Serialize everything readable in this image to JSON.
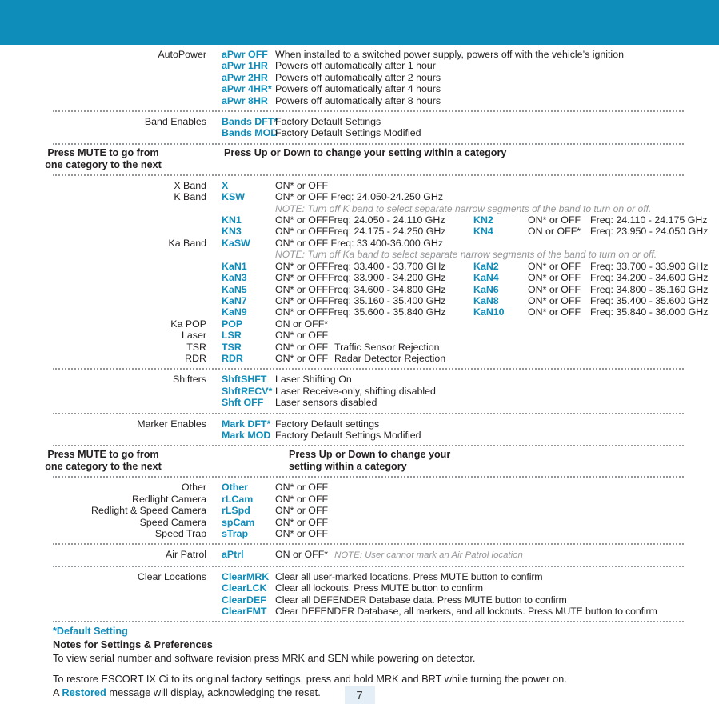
{
  "header": {
    "color": "#0e8cba"
  },
  "accent_color": "#0e8cba",
  "sections": [
    {
      "label": "AutoPower",
      "rows": [
        {
          "code": "aPwr OFF",
          "desc": "When installed to a switched power supply, powers off with the vehicle’s ignition"
        },
        {
          "code": "aPwr 1HR",
          "desc": "Powers off automatically after 1 hour"
        },
        {
          "code": "aPwr 2HR",
          "desc": "Powers off automatically after 2 hours"
        },
        {
          "code": "aPwr 4HR*",
          "desc": "Powers off automatically after 4 hours"
        },
        {
          "code": "aPwr 8HR",
          "desc": "Powers off automatically after 8 hours"
        }
      ]
    },
    {
      "label": "Band Enables",
      "rows": [
        {
          "code": "Bands DFT*",
          "desc": "Factory Default Settings"
        },
        {
          "code": "Bands MOD",
          "desc": "Factory Default Settings Modified"
        }
      ]
    }
  ],
  "band1": {
    "left": "Press MUTE to go from\none category to the next",
    "right": "Press Up or Down to change your setting within a category"
  },
  "bands_section": {
    "rows": [
      {
        "label": "X Band",
        "code": "X",
        "state": "ON* or OFF",
        "desc": ""
      },
      {
        "label": "K Band",
        "code": "KSW",
        "state": "ON* or OFF Freq: 24.050-24.250 GHz",
        "desc": ""
      },
      {
        "note": "NOTE: Turn off K band to select separate narrow segments of the band to turn on or off."
      },
      {
        "label": "",
        "code": "KN1",
        "state": "ON* or OFF",
        "desc": "Freq: 24.050 - 24.110 GHz",
        "code2": "KN2",
        "state2": "ON* or OFF",
        "desc2": "Freq: 24.110 - 24.175 GHz"
      },
      {
        "label": "",
        "code": "KN3",
        "state": "ON* or OFF",
        "desc": "Freq: 24.175 - 24.250 GHz",
        "code2": "KN4",
        "state2": "ON or OFF*",
        "desc2": "Freq: 23.950 - 24.050 GHz"
      },
      {
        "label": "Ka Band",
        "code": "KaSW",
        "state": "ON*  or OFF Freq: 33.400-36.000 GHz",
        "desc": ""
      },
      {
        "note": "NOTE: Turn off Ka band to select separate narrow segments of the band to turn on or off."
      },
      {
        "label": "",
        "code": "KaN1",
        "state": "ON* or OFF",
        "desc": "Freq: 33.400 - 33.700 GHz",
        "code2": "KaN2",
        "state2": "ON* or OFF",
        "desc2": "Freq: 33.700 - 33.900 GHz"
      },
      {
        "label": "",
        "code": "KaN3",
        "state": "ON* or OFF",
        "desc": "Freq: 33.900 - 34.200 GHz",
        "code2": "KaN4",
        "state2": "ON* or OFF",
        "desc2": "Freq: 34.200 - 34.600 GHz"
      },
      {
        "label": "",
        "code": "KaN5",
        "state": "ON* or OFF",
        "desc": "Freq: 34.600 - 34.800 GHz",
        "code2": "KaN6",
        "state2": "ON* or OFF",
        "desc2": "Freq: 34.800 - 35.160 GHz"
      },
      {
        "label": "",
        "code": "KaN7",
        "state": "ON* or OFF",
        "desc": "Freq: 35.160 - 35.400 GHz",
        "code2": "KaN8",
        "state2": "ON* or OFF",
        "desc2": "Freq: 35.400 - 35.600 GHz"
      },
      {
        "label": "",
        "code": "KaN9",
        "state": "ON* or OFF",
        "desc": "Freq: 35.600 - 35.840 GHz",
        "code2": "KaN10",
        "state2": "ON* or OFF",
        "desc2": "Freq: 35.840 - 36.000 GHz"
      },
      {
        "label": "Ka POP",
        "code": "POP",
        "state": "ON or OFF*",
        "desc": ""
      },
      {
        "label": "Laser",
        "code": "LSR",
        "state": "ON* or OFF",
        "desc": ""
      },
      {
        "label": "TSR",
        "code": "TSR",
        "state": "ON* or OFF",
        "desc": "Traffic Sensor Rejection"
      },
      {
        "label": "RDR",
        "code": "RDR",
        "state": "ON* or OFF",
        "desc": "Radar Detector Rejection"
      }
    ]
  },
  "shifters": {
    "label": "Shifters",
    "rows": [
      {
        "code": "ShftSHFT",
        "desc": "Laser Shifting On"
      },
      {
        "code": "ShftRECV*",
        "desc": "Laser Receive-only, shifting disabled"
      },
      {
        "code": "Shft OFF",
        "desc": "Laser sensors disabled"
      }
    ]
  },
  "marker_enables": {
    "label": "Marker Enables",
    "rows": [
      {
        "code": "Mark DFT*",
        "desc": "Factory Default settings"
      },
      {
        "code": "Mark MOD",
        "desc": "Factory Default Settings Modified"
      }
    ]
  },
  "band2": {
    "left": "Press MUTE to go from\none category to the next",
    "right": "Press Up or Down to change your\nsetting  within a category"
  },
  "markers": {
    "rows": [
      {
        "label": "Other",
        "code": "Other",
        "desc": "ON* or OFF"
      },
      {
        "label": "Redlight Camera",
        "code": "rLCam",
        "desc": "ON* or OFF"
      },
      {
        "label": "Redlight & Speed Camera",
        "code": "rLSpd",
        "desc": "ON* or OFF"
      },
      {
        "label": "Speed Camera",
        "code": "spCam",
        "desc": "ON* or OFF"
      },
      {
        "label": "Speed Trap",
        "code": "sTrap",
        "desc": "ON* or OFF"
      }
    ]
  },
  "air_patrol": {
    "label": "Air Patrol",
    "code": "aPtrl",
    "desc": "ON or OFF*",
    "note": "NOTE: User cannot mark an Air Patrol location"
  },
  "clear_locations": {
    "label": "Clear Locations",
    "rows": [
      {
        "code": "ClearMRK",
        "desc": "Clear all user-marked locations. Press MUTE button to confirm"
      },
      {
        "code": "ClearLCK",
        "desc": "Clear all lockouts. Press MUTE button to confirm"
      },
      {
        "code": "ClearDEF",
        "desc": "Clear all DEFENDER Database data. Press MUTE button to confirm"
      },
      {
        "code": "ClearFMT",
        "desc": "Clear DEFENDER Database, all markers, and all lockouts. Press MUTE button to confirm"
      }
    ]
  },
  "footer": {
    "default_setting": "*Default Setting",
    "notes_title": "Notes for Settings & Preferences",
    "note1": "To view serial number and software revision press MRK and SEN while powering on detector.",
    "note2": "To restore ESCORT IX Ci to its original factory settings, press and hold MRK and BRT while turning the power on.",
    "note3_pre": "A ",
    "note3_blue": "Restored",
    "note3_post": " message will display, acknowledging the reset.",
    "page_number": "7"
  }
}
